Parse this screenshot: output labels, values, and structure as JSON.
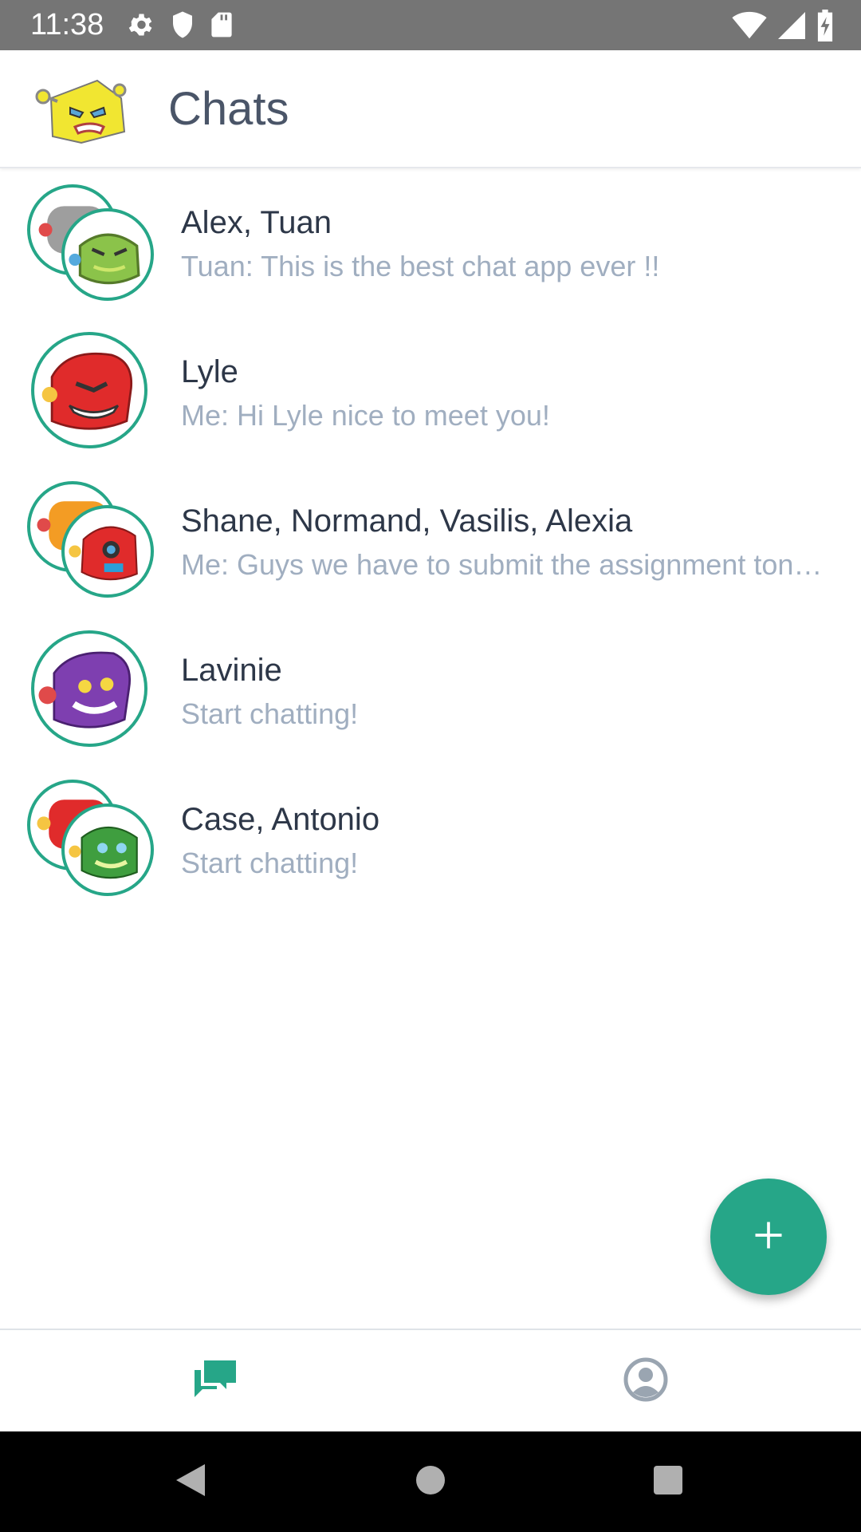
{
  "status_bar": {
    "time": "11:38",
    "icons_left": [
      "settings-icon",
      "shield-icon",
      "sd-card-icon"
    ],
    "icons_right": [
      "wifi-icon",
      "signal-icon",
      "battery-charging-icon"
    ]
  },
  "app_bar": {
    "title": "Chats",
    "logo": "robot-logo"
  },
  "chats": [
    {
      "name": "Alex, Tuan",
      "preview": "Tuan: This is the best chat app ever !!",
      "group": true
    },
    {
      "name": "Lyle",
      "preview": "Me: Hi Lyle nice to meet you!",
      "group": false
    },
    {
      "name": "Shane, Normand, Vasilis, Alexia",
      "preview": "Me: Guys we have to submit the assignment tonight",
      "group": true
    },
    {
      "name": "Lavinie",
      "preview": "Start chatting!",
      "group": false
    },
    {
      "name": "Case, Antonio",
      "preview": "Start chatting!",
      "group": true
    }
  ],
  "fab": {
    "icon": "plus-icon"
  },
  "bottom_nav": {
    "items": [
      {
        "icon": "chats-icon",
        "active": true
      },
      {
        "icon": "profile-icon",
        "active": false
      }
    ]
  },
  "system_nav": [
    "back-icon",
    "home-icon",
    "recents-icon"
  ],
  "colors": {
    "accent": "#26a688",
    "title": "#4a5568",
    "name": "#2d3748",
    "preview": "#a0aec0",
    "status_bar": "#757575"
  }
}
